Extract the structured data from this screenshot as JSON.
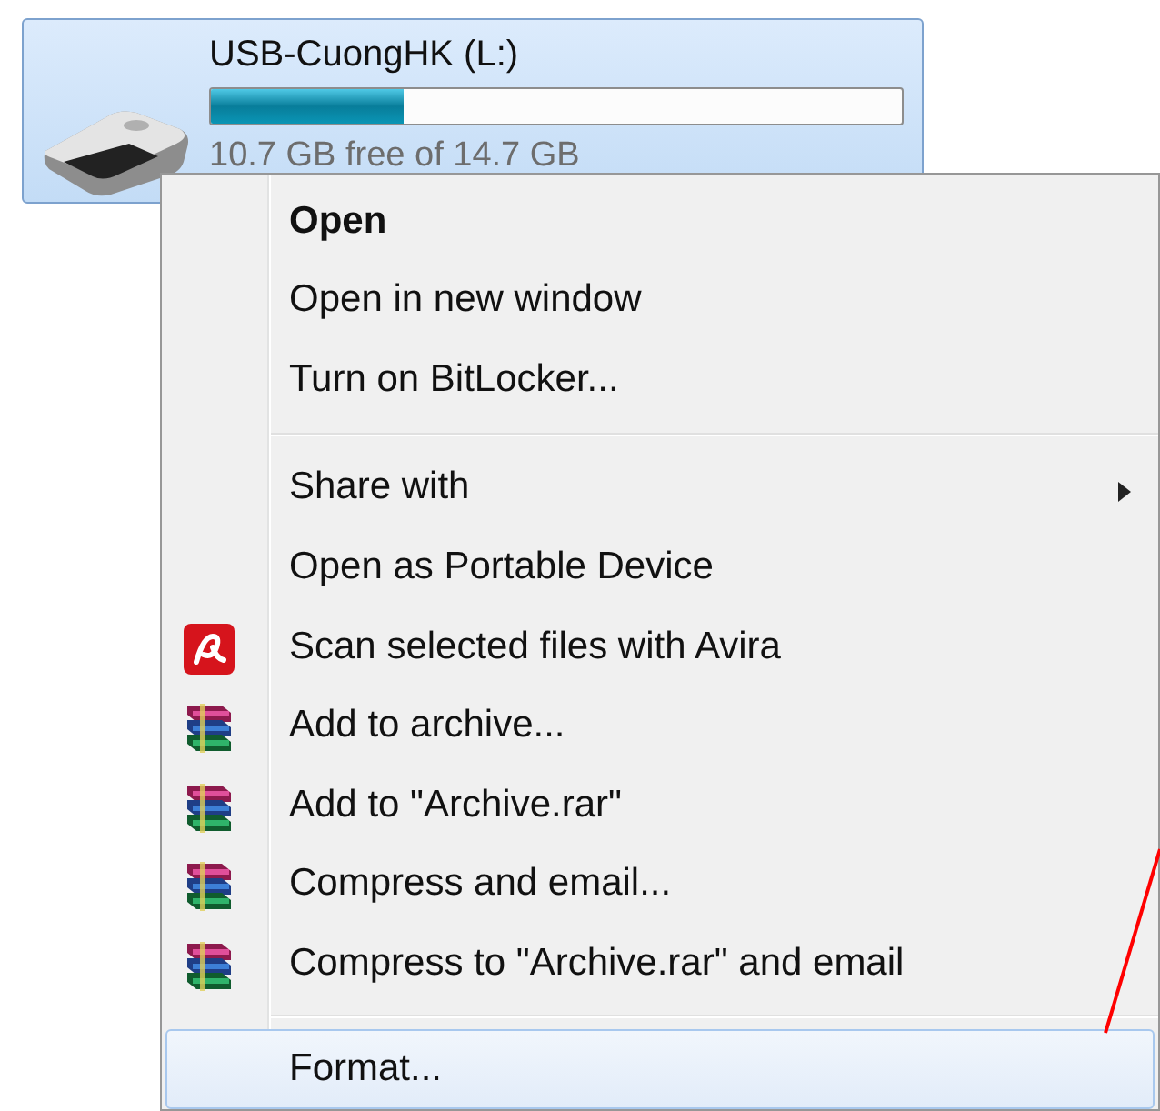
{
  "drive": {
    "name": "USB-CuongHK (L:)",
    "level": 0.28,
    "free_text": "10.7 GB free of 14.7 GB",
    "selected": true
  },
  "context_menu": {
    "items": [
      {
        "kind": "command",
        "label": "Open",
        "default": true,
        "selected": false
      },
      {
        "kind": "command",
        "label": "Open in new window",
        "default": false,
        "selected": false
      },
      {
        "kind": "command",
        "label": "Turn on BitLocker...",
        "default": false,
        "selected": false
      },
      {
        "kind": "separator"
      },
      {
        "kind": "submenu",
        "label": "Share with",
        "default": false,
        "selected": false
      },
      {
        "kind": "command",
        "label": "Open as Portable Device",
        "default": false,
        "selected": false
      },
      {
        "kind": "scan-command",
        "label": "Scan selected files with Avira",
        "default": false,
        "selected": false
      },
      {
        "kind": "archive-command",
        "label": "Add to archive...",
        "default": false,
        "selected": false
      },
      {
        "kind": "archive-command",
        "label": "Add to \"Archive.rar\"",
        "default": false,
        "selected": false
      },
      {
        "kind": "archive-command",
        "label": "Compress and email...",
        "default": false,
        "selected": false
      },
      {
        "kind": "archive-command",
        "label": "Compress to \"Archive.rar\" and email",
        "default": false,
        "selected": false
      },
      {
        "kind": "separator"
      },
      {
        "kind": "command",
        "label": "Format...",
        "default": false,
        "selected": true
      }
    ]
  }
}
